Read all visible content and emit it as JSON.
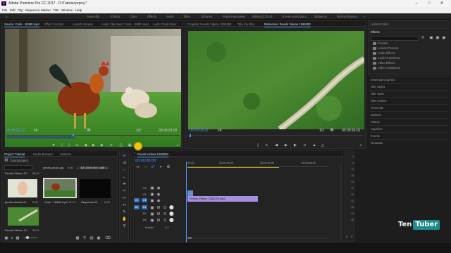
{
  "app": {
    "title": "Adobe Premiere Pro CC 2017 - D:\\Tutorial.prproj *",
    "icon_text": "Pr",
    "window_controls": [
      "minimize-icon",
      "maximize-icon",
      "close-icon"
    ]
  },
  "menu": [
    "File",
    "Edit",
    "Clip",
    "Sequence",
    "Marker",
    "Title",
    "Window",
    "Help"
  ],
  "workspaces": [
    "Assembly",
    "Editing",
    "Color",
    "Effects",
    "Audio",
    "Titles",
    "Libraries",
    "Редактирование",
    "Editing (CS5.5)",
    "Усечён workspace",
    "Эффекты",
    "Мой workspace"
  ],
  "source_monitor": {
    "tabs": [
      "Source: Cock - 18480.mp4",
      "Effect Controls",
      "Lumetri Scopes",
      "Audio Clip Mixer: Cock - 18480.mp4",
      "Audio Track Mixer"
    ],
    "timecode_in": "00:00:00:12",
    "fit": "Fit",
    "fraction": "1/2",
    "timecode_out": "00:00:02:02"
  },
  "program_monitor": {
    "tabs": [
      "Program: Pexels Videos 1266293",
      "Title (no title)",
      "Reference: Pexels Videos 1266293"
    ],
    "timecode_in": "00:00:00:00",
    "fit": "Fit",
    "fraction": "1/2",
    "timecode_out": "00:00:36:01"
  },
  "project": {
    "tabs": [
      "Project: Tutorial",
      "Media Browser",
      "Libraries"
    ],
    "file": "Tutorial.prproj",
    "selection": "1 of 7 items selected",
    "items": [
      {
        "name": "Pexels Videos 12...",
        "duration": "36:01"
      },
      {
        "name": "pexels-photo.jpg",
        "duration": "5:00"
      },
      {
        "name": "girl-2476434_1280...",
        "duration": "5:00"
      },
      {
        "name": "pexels-woman-fl...",
        "duration": "5:00"
      },
      {
        "name": "Cock - 18480.mp4",
        "duration": "12:12"
      },
      {
        "name": "Sequence 01",
        "duration": "0:00"
      },
      {
        "name": "Pexels Videos 12...",
        "duration": "36:01"
      }
    ]
  },
  "timeline": {
    "tab": "Pexels Videos 1266293",
    "timecode": "00:00:00:00",
    "ruler": [
      "00:00",
      "00:00:16:00",
      "00:00:32:00",
      "00:00:48:00"
    ],
    "video_tracks": [
      "V3",
      "V2",
      "V1"
    ],
    "audio_tracks": [
      "A1",
      "A2",
      "A3"
    ],
    "source_patch": [
      "V1",
      "A1"
    ],
    "master": "Master",
    "master_value": "0.0",
    "clip_name": "Pexels Videos 1266293.mp4"
  },
  "meter": {
    "labels": [
      "0",
      "-6",
      "-12",
      "-18",
      "-24",
      "-30",
      "-36",
      "-42",
      "-48",
      "-54",
      "dB"
    ],
    "footer": [
      "S",
      "S"
    ]
  },
  "lumetri": {
    "title": "Lumetri Color"
  },
  "effects": {
    "title": "Effects",
    "search_placeholder": "",
    "items": [
      "Presets",
      "Lumetri Presets",
      "Audio Effects",
      "Audio Transitions",
      "Video Effects",
      "Video Transitions"
    ]
  },
  "side_panels": [
    "Essential Graphics",
    "Title Styles",
    "Title Tools",
    "Title Actions",
    "Timecode",
    "Markers",
    "History",
    "Captions",
    "Events",
    "Metadata"
  ],
  "watermark": {
    "left": "Ten",
    "right": "Tuber"
  },
  "colors": {
    "accent": "#3b8de0",
    "clip_video": "#a78fe0",
    "clip_audio": "#3a9a72",
    "playhead": "#4d97ff",
    "cursor": "#f2c40a"
  }
}
